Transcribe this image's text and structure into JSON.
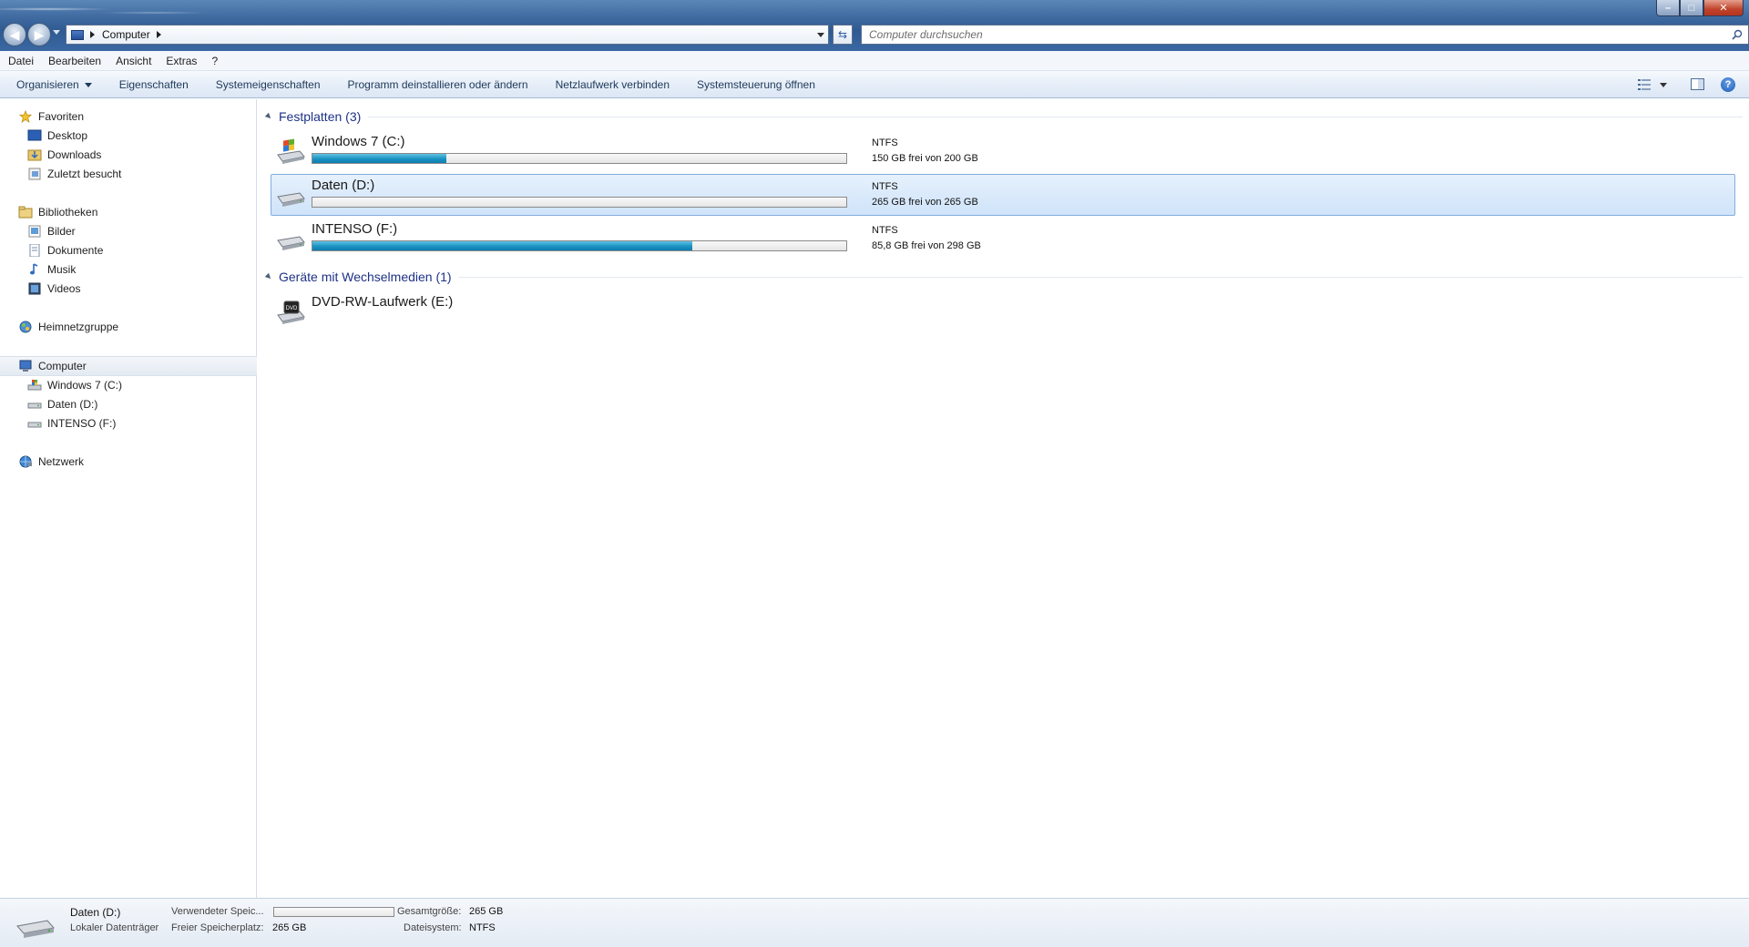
{
  "window": {
    "address": "Computer",
    "search_placeholder": "Computer durchsuchen",
    "controls": {
      "minimize": "–",
      "maximize": "□",
      "close": "✕"
    }
  },
  "menubar": [
    "Datei",
    "Bearbeiten",
    "Ansicht",
    "Extras",
    "?"
  ],
  "commandbar": {
    "organize": "Organisieren",
    "items": [
      "Eigenschaften",
      "Systemeigenschaften",
      "Programm deinstallieren oder ändern",
      "Netzlaufwerk verbinden",
      "Systemsteuerung öffnen"
    ]
  },
  "nav": {
    "favorites": {
      "label": "Favoriten",
      "items": [
        "Desktop",
        "Downloads",
        "Zuletzt besucht"
      ]
    },
    "libraries": {
      "label": "Bibliotheken",
      "items": [
        "Bilder",
        "Dokumente",
        "Musik",
        "Videos"
      ]
    },
    "homegroup": "Heimnetzgruppe",
    "computer": {
      "label": "Computer",
      "items": [
        "Windows 7 (C:)",
        "Daten (D:)",
        "INTENSO (F:)"
      ]
    },
    "network": "Netzwerk"
  },
  "groups": {
    "hard_disks": "Festplatten (3)",
    "removable": "Geräte mit Wechselmedien (1)"
  },
  "drives": [
    {
      "name": "Windows 7 (C:)",
      "fs": "NTFS",
      "free": "150 GB frei von 200 GB",
      "used_fraction": 0.25
    },
    {
      "name": "Daten (D:)",
      "fs": "NTFS",
      "free": "265 GB frei von 265 GB",
      "used_fraction": 0.0
    },
    {
      "name": "INTENSO (F:)",
      "fs": "NTFS",
      "free": "85,8 GB frei von 298 GB",
      "used_fraction": 0.712
    }
  ],
  "removable": [
    {
      "name": "DVD-RW-Laufwerk (E:)",
      "icon_label": "DVD"
    }
  ],
  "details": {
    "name": "Daten (D:)",
    "type": "Lokaler Datenträger",
    "used_label": "Verwendeter Speic...",
    "free_label": "Freier Speicherplatz:",
    "free_value": "265 GB",
    "total_label": "Gesamtgröße:",
    "total_value": "265 GB",
    "fs_label": "Dateisystem:",
    "fs_value": "NTFS",
    "used_fraction": 0.0
  },
  "colors": {
    "progress": "#1b92c2",
    "selection": "#cfe3fa",
    "group_title": "#1e3287"
  }
}
